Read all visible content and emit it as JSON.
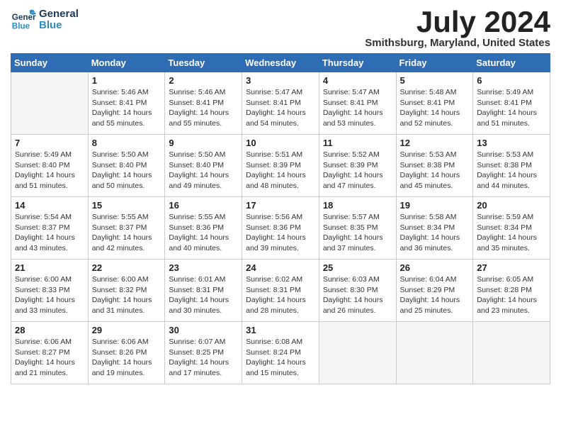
{
  "logo": {
    "line1": "General",
    "line2": "Blue"
  },
  "title": "July 2024",
  "location": "Smithsburg, Maryland, United States",
  "days_header": [
    "Sunday",
    "Monday",
    "Tuesday",
    "Wednesday",
    "Thursday",
    "Friday",
    "Saturday"
  ],
  "weeks": [
    [
      {
        "day": "",
        "info": ""
      },
      {
        "day": "1",
        "info": "Sunrise: 5:46 AM\nSunset: 8:41 PM\nDaylight: 14 hours\nand 55 minutes."
      },
      {
        "day": "2",
        "info": "Sunrise: 5:46 AM\nSunset: 8:41 PM\nDaylight: 14 hours\nand 55 minutes."
      },
      {
        "day": "3",
        "info": "Sunrise: 5:47 AM\nSunset: 8:41 PM\nDaylight: 14 hours\nand 54 minutes."
      },
      {
        "day": "4",
        "info": "Sunrise: 5:47 AM\nSunset: 8:41 PM\nDaylight: 14 hours\nand 53 minutes."
      },
      {
        "day": "5",
        "info": "Sunrise: 5:48 AM\nSunset: 8:41 PM\nDaylight: 14 hours\nand 52 minutes."
      },
      {
        "day": "6",
        "info": "Sunrise: 5:49 AM\nSunset: 8:41 PM\nDaylight: 14 hours\nand 51 minutes."
      }
    ],
    [
      {
        "day": "7",
        "info": "Sunrise: 5:49 AM\nSunset: 8:40 PM\nDaylight: 14 hours\nand 51 minutes."
      },
      {
        "day": "8",
        "info": "Sunrise: 5:50 AM\nSunset: 8:40 PM\nDaylight: 14 hours\nand 50 minutes."
      },
      {
        "day": "9",
        "info": "Sunrise: 5:50 AM\nSunset: 8:40 PM\nDaylight: 14 hours\nand 49 minutes."
      },
      {
        "day": "10",
        "info": "Sunrise: 5:51 AM\nSunset: 8:39 PM\nDaylight: 14 hours\nand 48 minutes."
      },
      {
        "day": "11",
        "info": "Sunrise: 5:52 AM\nSunset: 8:39 PM\nDaylight: 14 hours\nand 47 minutes."
      },
      {
        "day": "12",
        "info": "Sunrise: 5:53 AM\nSunset: 8:38 PM\nDaylight: 14 hours\nand 45 minutes."
      },
      {
        "day": "13",
        "info": "Sunrise: 5:53 AM\nSunset: 8:38 PM\nDaylight: 14 hours\nand 44 minutes."
      }
    ],
    [
      {
        "day": "14",
        "info": "Sunrise: 5:54 AM\nSunset: 8:37 PM\nDaylight: 14 hours\nand 43 minutes."
      },
      {
        "day": "15",
        "info": "Sunrise: 5:55 AM\nSunset: 8:37 PM\nDaylight: 14 hours\nand 42 minutes."
      },
      {
        "day": "16",
        "info": "Sunrise: 5:55 AM\nSunset: 8:36 PM\nDaylight: 14 hours\nand 40 minutes."
      },
      {
        "day": "17",
        "info": "Sunrise: 5:56 AM\nSunset: 8:36 PM\nDaylight: 14 hours\nand 39 minutes."
      },
      {
        "day": "18",
        "info": "Sunrise: 5:57 AM\nSunset: 8:35 PM\nDaylight: 14 hours\nand 37 minutes."
      },
      {
        "day": "19",
        "info": "Sunrise: 5:58 AM\nSunset: 8:34 PM\nDaylight: 14 hours\nand 36 minutes."
      },
      {
        "day": "20",
        "info": "Sunrise: 5:59 AM\nSunset: 8:34 PM\nDaylight: 14 hours\nand 35 minutes."
      }
    ],
    [
      {
        "day": "21",
        "info": "Sunrise: 6:00 AM\nSunset: 8:33 PM\nDaylight: 14 hours\nand 33 minutes."
      },
      {
        "day": "22",
        "info": "Sunrise: 6:00 AM\nSunset: 8:32 PM\nDaylight: 14 hours\nand 31 minutes."
      },
      {
        "day": "23",
        "info": "Sunrise: 6:01 AM\nSunset: 8:31 PM\nDaylight: 14 hours\nand 30 minutes."
      },
      {
        "day": "24",
        "info": "Sunrise: 6:02 AM\nSunset: 8:31 PM\nDaylight: 14 hours\nand 28 minutes."
      },
      {
        "day": "25",
        "info": "Sunrise: 6:03 AM\nSunset: 8:30 PM\nDaylight: 14 hours\nand 26 minutes."
      },
      {
        "day": "26",
        "info": "Sunrise: 6:04 AM\nSunset: 8:29 PM\nDaylight: 14 hours\nand 25 minutes."
      },
      {
        "day": "27",
        "info": "Sunrise: 6:05 AM\nSunset: 8:28 PM\nDaylight: 14 hours\nand 23 minutes."
      }
    ],
    [
      {
        "day": "28",
        "info": "Sunrise: 6:06 AM\nSunset: 8:27 PM\nDaylight: 14 hours\nand 21 minutes."
      },
      {
        "day": "29",
        "info": "Sunrise: 6:06 AM\nSunset: 8:26 PM\nDaylight: 14 hours\nand 19 minutes."
      },
      {
        "day": "30",
        "info": "Sunrise: 6:07 AM\nSunset: 8:25 PM\nDaylight: 14 hours\nand 17 minutes."
      },
      {
        "day": "31",
        "info": "Sunrise: 6:08 AM\nSunset: 8:24 PM\nDaylight: 14 hours\nand 15 minutes."
      },
      {
        "day": "",
        "info": ""
      },
      {
        "day": "",
        "info": ""
      },
      {
        "day": "",
        "info": ""
      }
    ]
  ]
}
